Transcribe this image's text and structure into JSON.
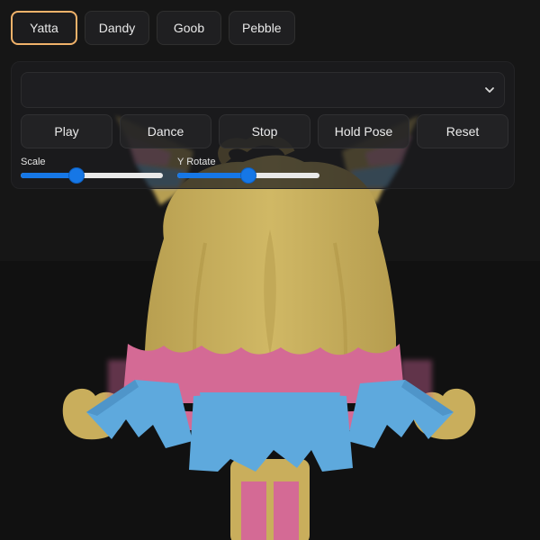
{
  "characters": {
    "tabs": [
      {
        "label": "Yatta",
        "active": true
      },
      {
        "label": "Dandy",
        "active": false
      },
      {
        "label": "Goob",
        "active": false
      },
      {
        "label": "Pebble",
        "active": false
      }
    ]
  },
  "controls": {
    "animation_select": {
      "value": "",
      "icon": "chevron-down-icon"
    },
    "buttons": {
      "play": "Play",
      "dance": "Dance",
      "stop": "Stop",
      "hold_pose": "Hold Pose",
      "reset": "Reset"
    },
    "sliders": {
      "scale": {
        "label": "Scale",
        "level": 0.39
      },
      "y_rotate": {
        "label": "Y Rotate",
        "level": 0.5
      }
    }
  },
  "colors": {
    "active_tab_border": "#f0b26a",
    "slider_accent": "#1677e6",
    "character_body": "#cbb25f",
    "character_pink": "#d96b95",
    "character_blue": "#5ea9dd"
  }
}
